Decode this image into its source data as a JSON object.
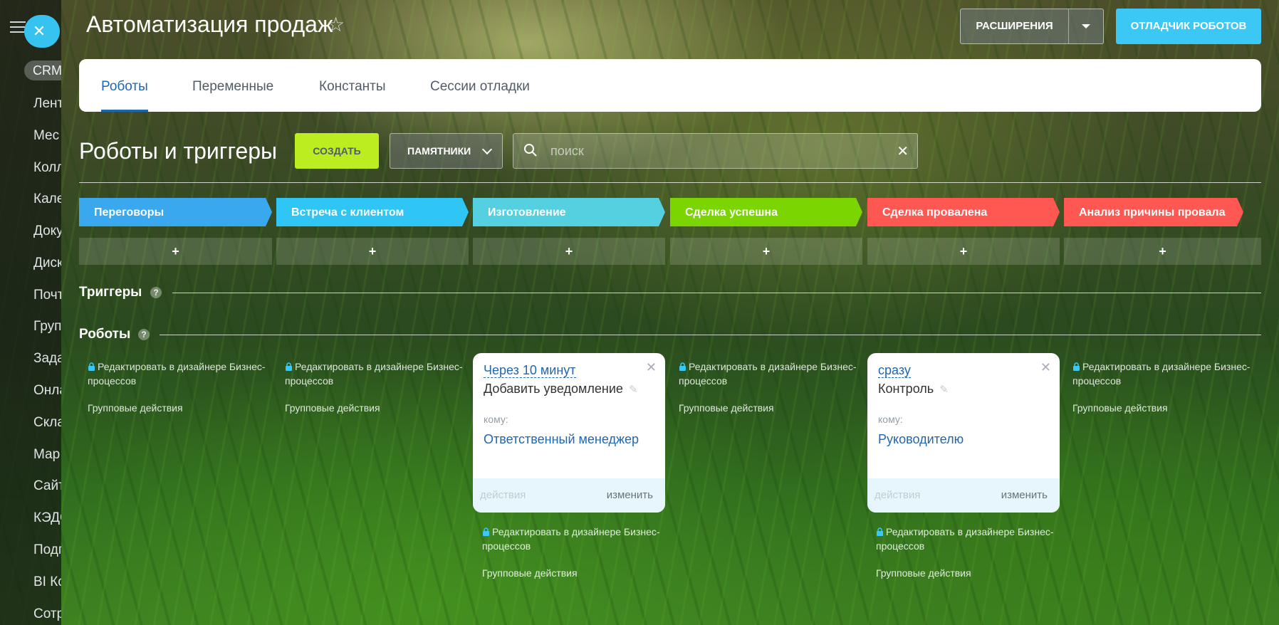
{
  "sidebar": {
    "crm_label": "CRM",
    "items": [
      "Лент",
      "Мес",
      "Колл",
      "Кале",
      "Доку",
      "Диск",
      "Почт",
      "Груп",
      "Зада",
      "Онла",
      "Скла",
      "Мар",
      "Сайт",
      "КЭДО",
      "Подп",
      "BI Ко",
      "Сотр"
    ]
  },
  "header": {
    "title": "Автоматизация продаж",
    "extensions_label": "РАСШИРЕНИЯ",
    "debugger_label": "ОТЛАДЧИК РОБОТОВ"
  },
  "tabs": [
    {
      "label": "Роботы",
      "active": true
    },
    {
      "label": "Переменные",
      "active": false
    },
    {
      "label": "Константы",
      "active": false
    },
    {
      "label": "Сессии отладки",
      "active": false
    }
  ],
  "toolbar": {
    "section_title": "Роботы и триггеры",
    "create_label": "СОЗДАТЬ",
    "memo_label": "ПАМЯТНИКИ",
    "search_placeholder": "поиск"
  },
  "stages": [
    {
      "label": "Переговоры",
      "color": "#39a8ef"
    },
    {
      "label": "Встреча с клиентом",
      "color": "#2fc6f6"
    },
    {
      "label": "Изготовление",
      "color": "#55d0e0"
    },
    {
      "label": "Сделка успешна",
      "color": "#7bd500"
    },
    {
      "label": "Сделка провалена",
      "color": "#ff5752"
    },
    {
      "label": "Анализ причины провала",
      "color": "#ff5752"
    }
  ],
  "add_label": "+",
  "sections": {
    "triggers": "Триггеры",
    "robots": "Роботы",
    "help": "?"
  },
  "column": {
    "edit_label": "Редактировать в дизайнере Бизнес-процессов",
    "group_label": "Групповые действия"
  },
  "robots": [
    {
      "when": "Через 10 минут",
      "title": "Добавить уведомление",
      "to_label": "кому:",
      "to_value": "Ответственный менеджер",
      "actions_label": "действия",
      "change_label": "изменить"
    },
    {
      "when": "сразу",
      "title": "Контроль",
      "to_label": "кому:",
      "to_value": "Руководителю",
      "actions_label": "действия",
      "change_label": "изменить"
    }
  ]
}
